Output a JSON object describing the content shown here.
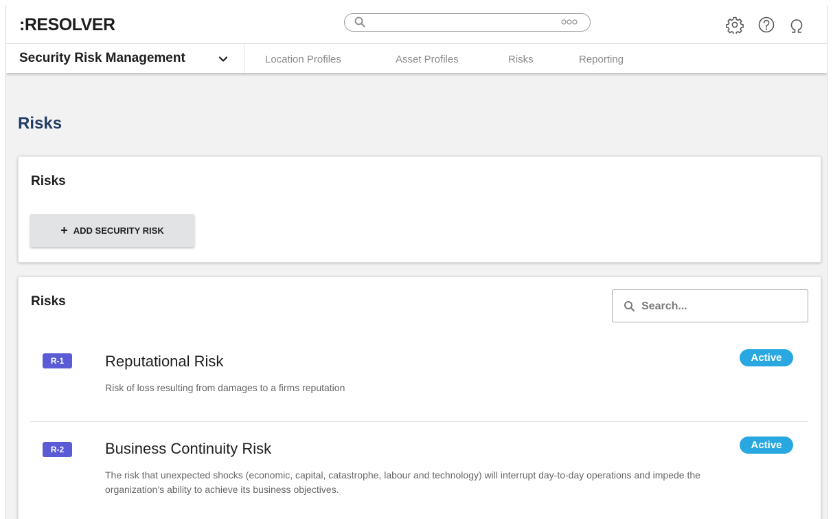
{
  "brand": {
    "logo": ":RESOLVER"
  },
  "global_search": {
    "placeholder": "",
    "more_icon": "more-dots-icon",
    "search_icon": "search-icon"
  },
  "top_icons": [
    "gear-icon",
    "help-icon",
    "user-icon"
  ],
  "nav": {
    "app_name": "Security Risk Management",
    "tabs": [
      "Location Profiles",
      "Asset Profiles",
      "Risks",
      "Reporting"
    ]
  },
  "page": {
    "title": "Risks"
  },
  "add_card": {
    "title": "Risks",
    "add_button_label": "ADD SECURITY RISK"
  },
  "list_card": {
    "title": "Risks",
    "search_placeholder": "Search...",
    "items": [
      {
        "id": "R-1",
        "name": "Reputational Risk",
        "description": "Risk of loss resulting from damages to a firms reputation",
        "status": "Active"
      },
      {
        "id": "R-2",
        "name": "Business Continuity Risk",
        "description": "The risk that unexpected shocks (economic, capital, catastrophe, labour and technology) will interrupt day-to-day operations and impede the organization’s ability to achieve its business objectives.",
        "status": "Active"
      }
    ]
  },
  "colors": {
    "page_title": "#213d63",
    "id_badge": "#5b5bd6",
    "status_active": "#28a7e0",
    "page_background": "#f2f2f2"
  }
}
